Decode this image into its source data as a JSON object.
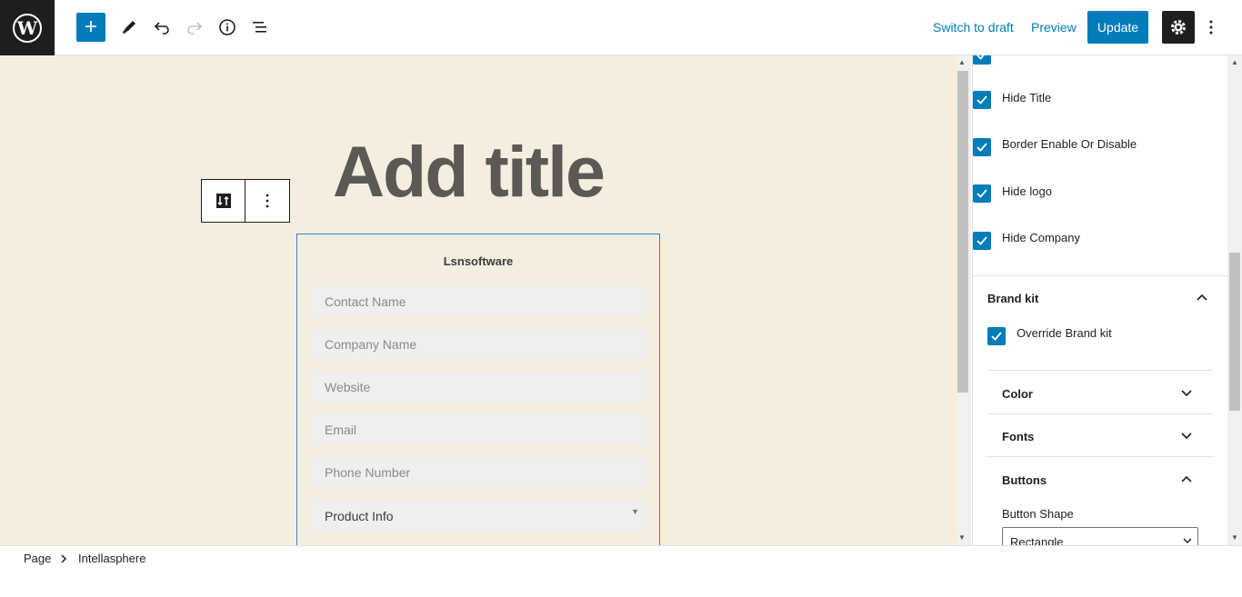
{
  "header": {
    "add_block_label": "+",
    "switch_to_draft": "Switch to draft",
    "preview": "Preview",
    "update": "Update"
  },
  "editor": {
    "title_placeholder": "Add title",
    "form": {
      "heading": "Lsnsoftware",
      "fields": [
        "Contact Name",
        "Company Name",
        "Website",
        "Email",
        "Phone Number"
      ],
      "select_value": "Product Info"
    }
  },
  "sidebar": {
    "checkboxes": [
      {
        "label": "Hide Title",
        "checked": true
      },
      {
        "label": "Border Enable Or Disable",
        "checked": true
      },
      {
        "label": "Hide logo",
        "checked": true
      },
      {
        "label": "Hide Company",
        "checked": true
      }
    ],
    "brand_kit": {
      "title": "Brand kit",
      "override_label": "Override Brand kit",
      "sections": [
        "Color",
        "Fonts",
        "Buttons"
      ],
      "button_shape_label": "Button Shape",
      "button_shape_value": "Rectangle"
    }
  },
  "footer": {
    "breadcrumb": [
      "Page",
      "Intellasphere"
    ]
  },
  "colors": {
    "accent": "#007cba",
    "canvas_bg": "#f4eedf",
    "dark": "#1e1e1e"
  }
}
